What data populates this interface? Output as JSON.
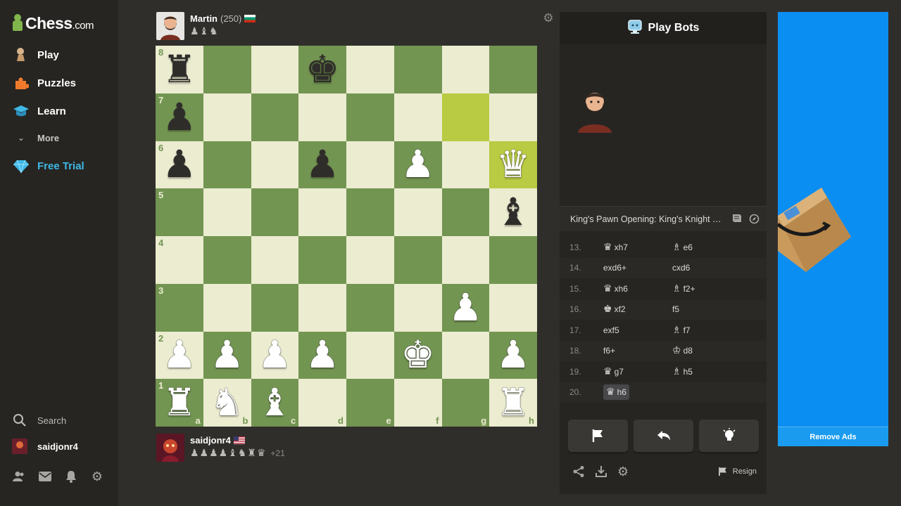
{
  "app": {
    "logo_text": "Chess",
    "logo_suffix": ".com"
  },
  "sidebar": {
    "items": [
      {
        "label": "Play",
        "icon": "play-pawn-icon"
      },
      {
        "label": "Puzzles",
        "icon": "puzzle-icon"
      },
      {
        "label": "Learn",
        "icon": "graduation-cap-icon"
      },
      {
        "label": "More",
        "icon": "chevron-down-icon"
      },
      {
        "label": "Free Trial",
        "icon": "diamond-icon"
      }
    ],
    "search_label": "Search",
    "username": "saidjonr4",
    "bottom_icons": [
      "friends-icon",
      "messages-icon",
      "notifications-icon",
      "settings-icon"
    ]
  },
  "opponent": {
    "name": "Martin",
    "rating": "(250)",
    "flag": "bulgaria",
    "captured": "♟♝♞"
  },
  "player": {
    "name": "saidjonr4",
    "flag": "usa",
    "captured": "♟♟♟♟♝♞♜♛",
    "advantage": "+21"
  },
  "board": {
    "ranks": [
      "8",
      "7",
      "6",
      "5",
      "4",
      "3",
      "2",
      "1"
    ],
    "files": [
      "a",
      "b",
      "c",
      "d",
      "e",
      "f",
      "g",
      "h"
    ],
    "position": [
      [
        "r",
        "",
        "",
        "k",
        "",
        "",
        "",
        ""
      ],
      [
        "p",
        "",
        "",
        "",
        "",
        "",
        "",
        ""
      ],
      [
        "p",
        "",
        "",
        "p",
        "",
        "P",
        "",
        "Q"
      ],
      [
        "",
        "",
        "",
        "",
        "",
        "",
        "",
        "b"
      ],
      [
        "",
        "",
        "",
        "",
        "",
        "",
        "",
        ""
      ],
      [
        "",
        "",
        "",
        "",
        "",
        "",
        "P",
        ""
      ],
      [
        "P",
        "P",
        "P",
        "P",
        "",
        "K",
        "",
        "P"
      ],
      [
        "R",
        "N",
        "B",
        "",
        "",
        "",
        "",
        "R"
      ]
    ],
    "highlights": [
      "g7",
      "h6"
    ]
  },
  "panel": {
    "title": "Play Bots",
    "opening": "King's Pawn Opening: King's Knight Variation",
    "moves": [
      {
        "num": "13.",
        "white": "xh7",
        "white_piece": "♛",
        "black": "e6",
        "black_piece": "♗"
      },
      {
        "num": "14.",
        "white": "exd6+",
        "white_piece": "",
        "black": "cxd6",
        "black_piece": ""
      },
      {
        "num": "15.",
        "white": "xh6",
        "white_piece": "♛",
        "black": "f2+",
        "black_piece": "♗"
      },
      {
        "num": "16.",
        "white": "xf2",
        "white_piece": "♚",
        "black": "f5",
        "black_piece": ""
      },
      {
        "num": "17.",
        "white": "exf5",
        "white_piece": "",
        "black": "f7",
        "black_piece": "♗"
      },
      {
        "num": "18.",
        "white": "f6+",
        "white_piece": "",
        "black": "d8",
        "black_piece": "♔"
      },
      {
        "num": "19.",
        "white": "g7",
        "white_piece": "♛",
        "black": "h5",
        "black_piece": "♗"
      },
      {
        "num": "20.",
        "white": "h6",
        "white_piece": "♛",
        "black": "",
        "black_piece": ""
      }
    ],
    "resign_label": "Resign"
  },
  "ad": {
    "remove_label": "Remove Ads"
  }
}
